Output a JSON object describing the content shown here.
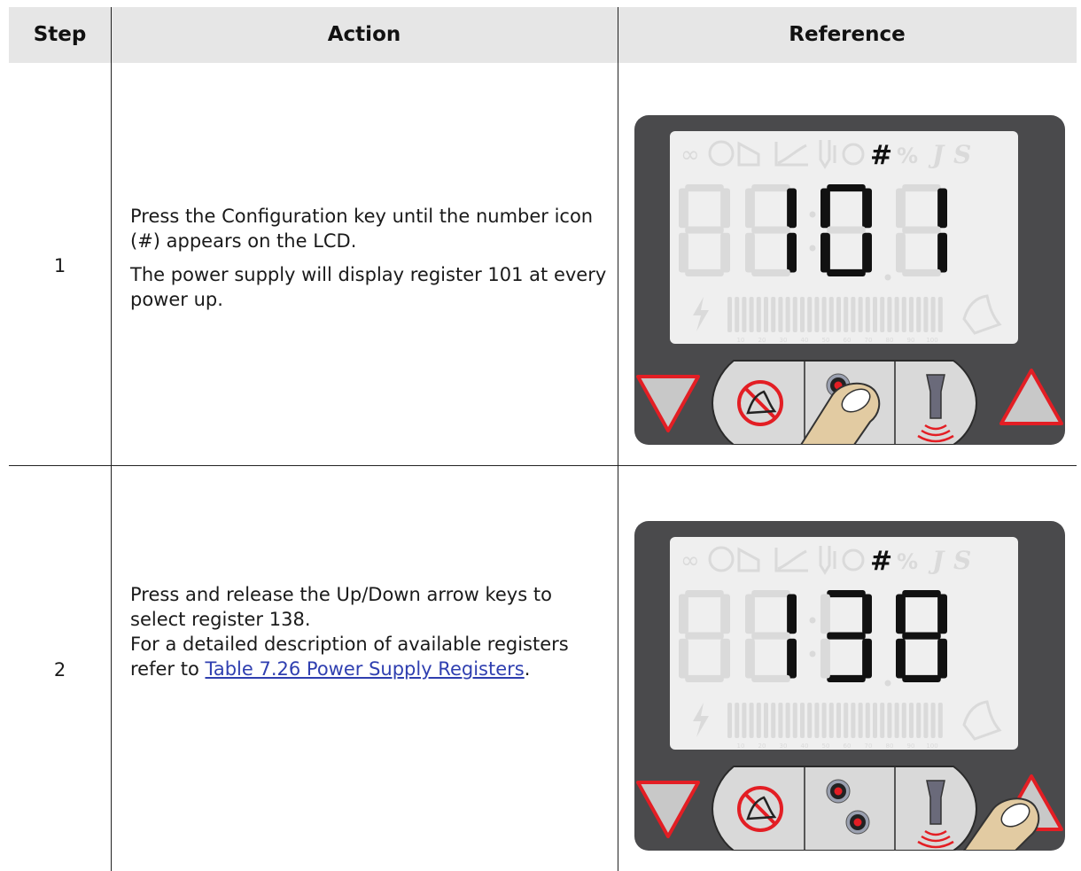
{
  "table": {
    "headers": {
      "step": "Step",
      "action": "Action",
      "reference": "Reference"
    },
    "rows": [
      {
        "step": "1",
        "action_line1": "Press the Configuration key until the number icon (#) appears on the LCD.",
        "action_line2": "The power supply will display register 101 at every power up.",
        "display_digits": [
          "",
          "1",
          "0",
          "1"
        ],
        "pressed_key": "configuration"
      },
      {
        "step": "2",
        "action_text": "Press and release the Up/Down arrow keys to select register 138.",
        "action_text2_prefix": "For a detailed description of available registers refer to ",
        "link_text": "Table 7.26 Power Supply Registers",
        "action_text2_suffix": ".",
        "display_digits": [
          "",
          "1",
          "3",
          "8"
        ],
        "pressed_key": "up-arrow"
      }
    ]
  },
  "lcd": {
    "number_icon": "#",
    "faded_icons": [
      "∞",
      "%",
      "J",
      "S"
    ],
    "bar_scale": [
      "10",
      "20",
      "30",
      "40",
      "50",
      "60",
      "70",
      "80",
      "90",
      "100"
    ]
  },
  "colors": {
    "header_bg": "#e6e6e6",
    "device_body": "#4a4a4c",
    "lcd_bg": "#efefef",
    "lcd_faded": "#dadada",
    "arrow_red": "#e31e24",
    "link": "#2f3fb0"
  }
}
